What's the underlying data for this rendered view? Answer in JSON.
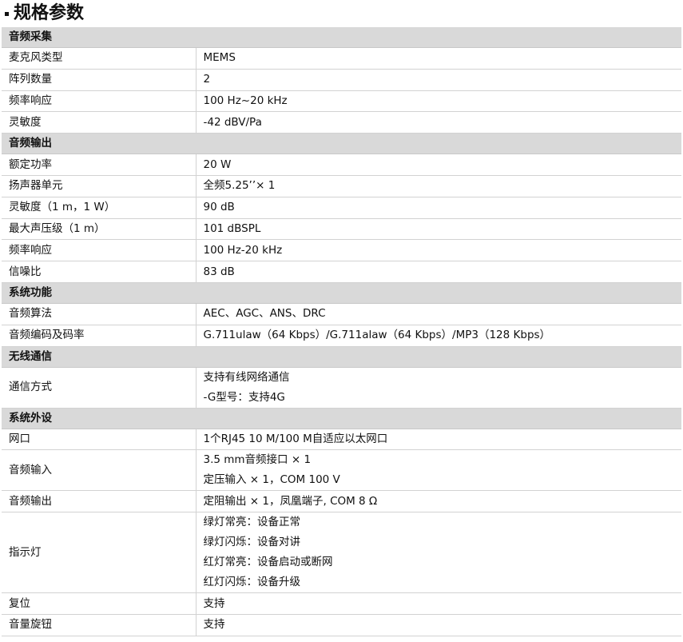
{
  "title": "规格参数",
  "sections": [
    {
      "name": "音频采集",
      "rows": [
        {
          "key": "麦克风类型",
          "values": [
            "MEMS"
          ]
        },
        {
          "key": "阵列数量",
          "values": [
            "2"
          ]
        },
        {
          "key": "频率响应",
          "values": [
            "100 Hz~20 kHz"
          ]
        },
        {
          "key": "灵敏度",
          "values": [
            "-42 dBV/Pa"
          ]
        }
      ]
    },
    {
      "name": "音频输出",
      "rows": [
        {
          "key": "额定功率",
          "values": [
            "20 W"
          ]
        },
        {
          "key": "扬声器单元",
          "values": [
            "全频5.25’’× 1"
          ]
        },
        {
          "key": "灵敏度（1 m，1 W）",
          "values": [
            "90 dB"
          ]
        },
        {
          "key": "最大声压级（1 m）",
          "values": [
            "101 dBSPL"
          ]
        },
        {
          "key": "频率响应",
          "values": [
            "100 Hz-20 kHz"
          ]
        },
        {
          "key": "信噪比",
          "values": [
            "83 dB"
          ]
        }
      ]
    },
    {
      "name": "系统功能",
      "rows": [
        {
          "key": "音频算法",
          "values": [
            "AEC、AGC、ANS、DRC"
          ]
        },
        {
          "key": "音频编码及码率",
          "values": [
            "G.711ulaw（64 Kbps）/G.711alaw（64 Kbps）/MP3（128 Kbps）"
          ]
        }
      ]
    },
    {
      "name": "无线通信",
      "rows": [
        {
          "key": "通信方式",
          "values": [
            "支持有线网络通信",
            "-G型号：支持4G"
          ]
        }
      ]
    },
    {
      "name": "系统外设",
      "rows": [
        {
          "key": "网口",
          "values": [
            "1个RJ45 10 M/100 M自适应以太网口"
          ]
        },
        {
          "key": "音频输入",
          "values": [
            "3.5 mm音频接口 × 1",
            "定压输入 × 1，COM 100 V"
          ]
        },
        {
          "key": "音频输出",
          "values": [
            "定阻输出 × 1，凤凰端子, COM 8 Ω"
          ]
        },
        {
          "key": "指示灯",
          "values": [
            "绿灯常亮：设备正常",
            "绿灯闪烁：设备对讲",
            "红灯常亮：设备启动或断网",
            "红灯闪烁：设备升级"
          ]
        },
        {
          "key": "复位",
          "values": [
            "支持"
          ]
        },
        {
          "key": "音量旋钮",
          "values": [
            "支持"
          ]
        }
      ]
    }
  ]
}
